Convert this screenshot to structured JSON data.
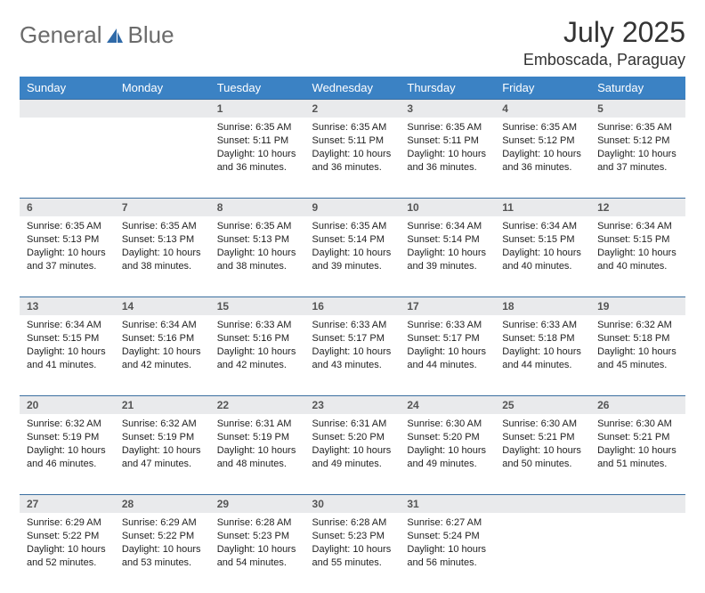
{
  "logo": {
    "text1": "General",
    "text2": "Blue"
  },
  "title": "July 2025",
  "location": "Emboscada, Paraguay",
  "weekdays": [
    "Sunday",
    "Monday",
    "Tuesday",
    "Wednesday",
    "Thursday",
    "Friday",
    "Saturday"
  ],
  "weeks": [
    [
      null,
      null,
      {
        "n": "1",
        "sunrise": "6:35 AM",
        "sunset": "5:11 PM",
        "daylight": "10 hours and 36 minutes."
      },
      {
        "n": "2",
        "sunrise": "6:35 AM",
        "sunset": "5:11 PM",
        "daylight": "10 hours and 36 minutes."
      },
      {
        "n": "3",
        "sunrise": "6:35 AM",
        "sunset": "5:11 PM",
        "daylight": "10 hours and 36 minutes."
      },
      {
        "n": "4",
        "sunrise": "6:35 AM",
        "sunset": "5:12 PM",
        "daylight": "10 hours and 36 minutes."
      },
      {
        "n": "5",
        "sunrise": "6:35 AM",
        "sunset": "5:12 PM",
        "daylight": "10 hours and 37 minutes."
      }
    ],
    [
      {
        "n": "6",
        "sunrise": "6:35 AM",
        "sunset": "5:13 PM",
        "daylight": "10 hours and 37 minutes."
      },
      {
        "n": "7",
        "sunrise": "6:35 AM",
        "sunset": "5:13 PM",
        "daylight": "10 hours and 38 minutes."
      },
      {
        "n": "8",
        "sunrise": "6:35 AM",
        "sunset": "5:13 PM",
        "daylight": "10 hours and 38 minutes."
      },
      {
        "n": "9",
        "sunrise": "6:35 AM",
        "sunset": "5:14 PM",
        "daylight": "10 hours and 39 minutes."
      },
      {
        "n": "10",
        "sunrise": "6:34 AM",
        "sunset": "5:14 PM",
        "daylight": "10 hours and 39 minutes."
      },
      {
        "n": "11",
        "sunrise": "6:34 AM",
        "sunset": "5:15 PM",
        "daylight": "10 hours and 40 minutes."
      },
      {
        "n": "12",
        "sunrise": "6:34 AM",
        "sunset": "5:15 PM",
        "daylight": "10 hours and 40 minutes."
      }
    ],
    [
      {
        "n": "13",
        "sunrise": "6:34 AM",
        "sunset": "5:15 PM",
        "daylight": "10 hours and 41 minutes."
      },
      {
        "n": "14",
        "sunrise": "6:34 AM",
        "sunset": "5:16 PM",
        "daylight": "10 hours and 42 minutes."
      },
      {
        "n": "15",
        "sunrise": "6:33 AM",
        "sunset": "5:16 PM",
        "daylight": "10 hours and 42 minutes."
      },
      {
        "n": "16",
        "sunrise": "6:33 AM",
        "sunset": "5:17 PM",
        "daylight": "10 hours and 43 minutes."
      },
      {
        "n": "17",
        "sunrise": "6:33 AM",
        "sunset": "5:17 PM",
        "daylight": "10 hours and 44 minutes."
      },
      {
        "n": "18",
        "sunrise": "6:33 AM",
        "sunset": "5:18 PM",
        "daylight": "10 hours and 44 minutes."
      },
      {
        "n": "19",
        "sunrise": "6:32 AM",
        "sunset": "5:18 PM",
        "daylight": "10 hours and 45 minutes."
      }
    ],
    [
      {
        "n": "20",
        "sunrise": "6:32 AM",
        "sunset": "5:19 PM",
        "daylight": "10 hours and 46 minutes."
      },
      {
        "n": "21",
        "sunrise": "6:32 AM",
        "sunset": "5:19 PM",
        "daylight": "10 hours and 47 minutes."
      },
      {
        "n": "22",
        "sunrise": "6:31 AM",
        "sunset": "5:19 PM",
        "daylight": "10 hours and 48 minutes."
      },
      {
        "n": "23",
        "sunrise": "6:31 AM",
        "sunset": "5:20 PM",
        "daylight": "10 hours and 49 minutes."
      },
      {
        "n": "24",
        "sunrise": "6:30 AM",
        "sunset": "5:20 PM",
        "daylight": "10 hours and 49 minutes."
      },
      {
        "n": "25",
        "sunrise": "6:30 AM",
        "sunset": "5:21 PM",
        "daylight": "10 hours and 50 minutes."
      },
      {
        "n": "26",
        "sunrise": "6:30 AM",
        "sunset": "5:21 PM",
        "daylight": "10 hours and 51 minutes."
      }
    ],
    [
      {
        "n": "27",
        "sunrise": "6:29 AM",
        "sunset": "5:22 PM",
        "daylight": "10 hours and 52 minutes."
      },
      {
        "n": "28",
        "sunrise": "6:29 AM",
        "sunset": "5:22 PM",
        "daylight": "10 hours and 53 minutes."
      },
      {
        "n": "29",
        "sunrise": "6:28 AM",
        "sunset": "5:23 PM",
        "daylight": "10 hours and 54 minutes."
      },
      {
        "n": "30",
        "sunrise": "6:28 AM",
        "sunset": "5:23 PM",
        "daylight": "10 hours and 55 minutes."
      },
      {
        "n": "31",
        "sunrise": "6:27 AM",
        "sunset": "5:24 PM",
        "daylight": "10 hours and 56 minutes."
      },
      null,
      null
    ]
  ],
  "labels": {
    "sunrise": "Sunrise: ",
    "sunset": "Sunset: ",
    "daylight": "Daylight: "
  }
}
